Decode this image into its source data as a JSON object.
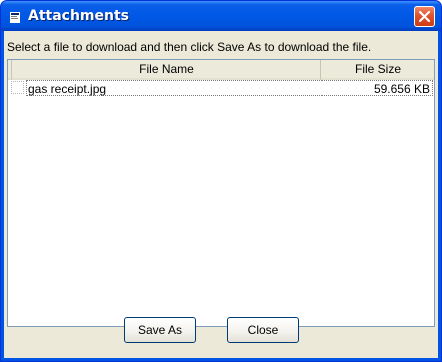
{
  "window": {
    "title": "Attachments",
    "icon": "window-icon",
    "close_icon": "close-icon"
  },
  "instructions": "Select a file to download and then click Save As to download the file.",
  "list": {
    "columns": [
      "File Name",
      "File Size"
    ],
    "rows": [
      {
        "name": "gas receipt.jpg",
        "size": "59.656 KB"
      }
    ]
  },
  "buttons": {
    "save_as": "Save As",
    "close": "Close"
  },
  "colors": {
    "titlebar": "#0058e6",
    "client_bg": "#ece9d8",
    "close_button": "#e0532c"
  }
}
